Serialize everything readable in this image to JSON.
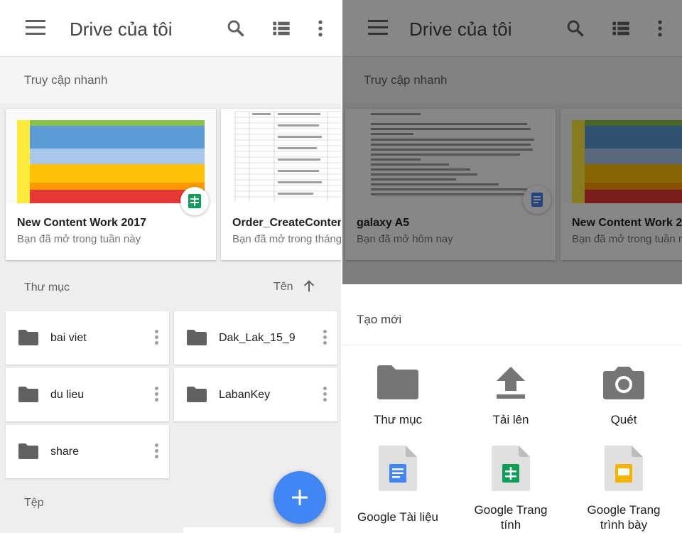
{
  "left": {
    "header": {
      "title": "Drive của tôi"
    },
    "quick_access": {
      "label": "Truy cập nhanh",
      "cards": [
        {
          "name": "New Content Work 2017",
          "sub": "Bạn đã mở trong tuần này"
        },
        {
          "name": "Order_CreateContent_",
          "sub": "Bạn đã mở trong tháng"
        }
      ]
    },
    "folders_section": {
      "label": "Thư mục",
      "sort_label": "Tên"
    },
    "folders": [
      {
        "name": "bai viet"
      },
      {
        "name": "Dak_Lak_15_9"
      },
      {
        "name": "du lieu"
      },
      {
        "name": "LabanKey"
      },
      {
        "name": "share"
      }
    ],
    "files_section": {
      "label": "Tệp"
    },
    "fab": {
      "icon": "plus-icon",
      "color": "#4285f4"
    }
  },
  "right": {
    "header": {
      "title": "Drive của tôi"
    },
    "quick_access": {
      "label": "Truy cập nhanh",
      "cards": [
        {
          "name": "galaxy A5",
          "sub": "Bạn đã mở hôm nay"
        },
        {
          "name": "New Content Work 20",
          "sub": "Bạn đã mở trong tuần n"
        }
      ]
    },
    "sheet": {
      "title": "Tạo mới",
      "options": [
        {
          "label": "Thư mục",
          "icon": "folder-icon"
        },
        {
          "label": "Tải lên",
          "icon": "upload-icon"
        },
        {
          "label": "Quét",
          "icon": "camera-icon"
        },
        {
          "label": "Google Tài liệu",
          "icon": "docs-icon"
        },
        {
          "label_line1": "Google Trang",
          "label_line2": "tính",
          "icon": "sheets-icon"
        },
        {
          "label_line1": "Google Trang",
          "label_line2": "trình bày",
          "icon": "slides-icon"
        }
      ]
    }
  },
  "colors": {
    "accent": "#4285f4",
    "docs": "#4285f4",
    "sheets": "#0f9d58",
    "slides": "#f4b400",
    "icon_gray": "#616161"
  }
}
